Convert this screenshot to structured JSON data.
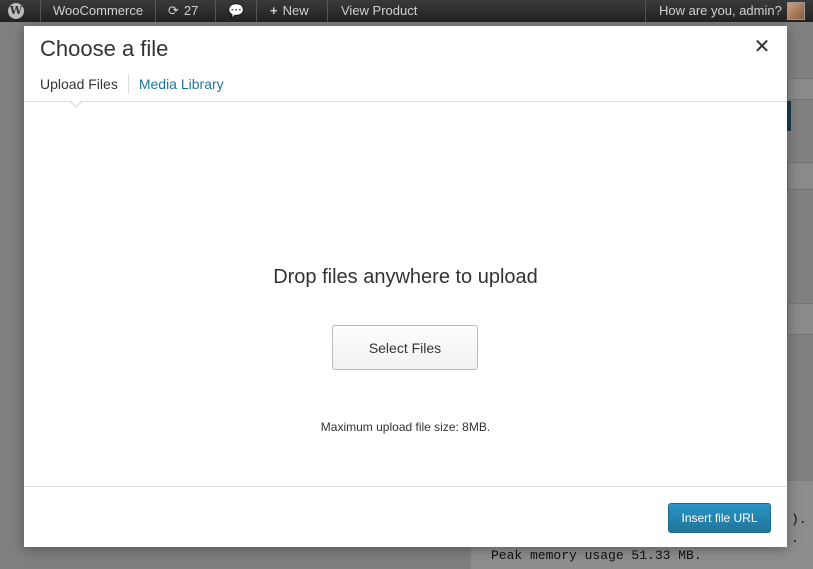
{
  "admin_bar": {
    "site_menu": "WooCommerce",
    "updates_count": "27",
    "new_label": "New",
    "view_product": "View Product",
    "greeting": "How are you, admin?"
  },
  "background": {
    "memory_line": "Peak memory usage 51.33 MB.",
    "mono_fragment_1": ").",
    "mono_fragment_2": "."
  },
  "modal": {
    "title": "Choose a file",
    "tabs": [
      {
        "label": "Upload Files",
        "active": true
      },
      {
        "label": "Media Library",
        "active": false
      }
    ],
    "drop_text": "Drop files anywhere to upload",
    "select_files_label": "Select Files",
    "max_upload": "Maximum upload file size: 8MB.",
    "insert_url_label": "Insert file URL"
  },
  "colors": {
    "link": "#21759b",
    "primary_button": "#2a95c5",
    "admin_bar": "#222222"
  },
  "icons": {
    "wp_logo": "wordpress-logo-icon",
    "updates": "refresh-icon",
    "comments": "comment-bubble-icon",
    "new": "plus-icon",
    "close": "close-icon"
  }
}
